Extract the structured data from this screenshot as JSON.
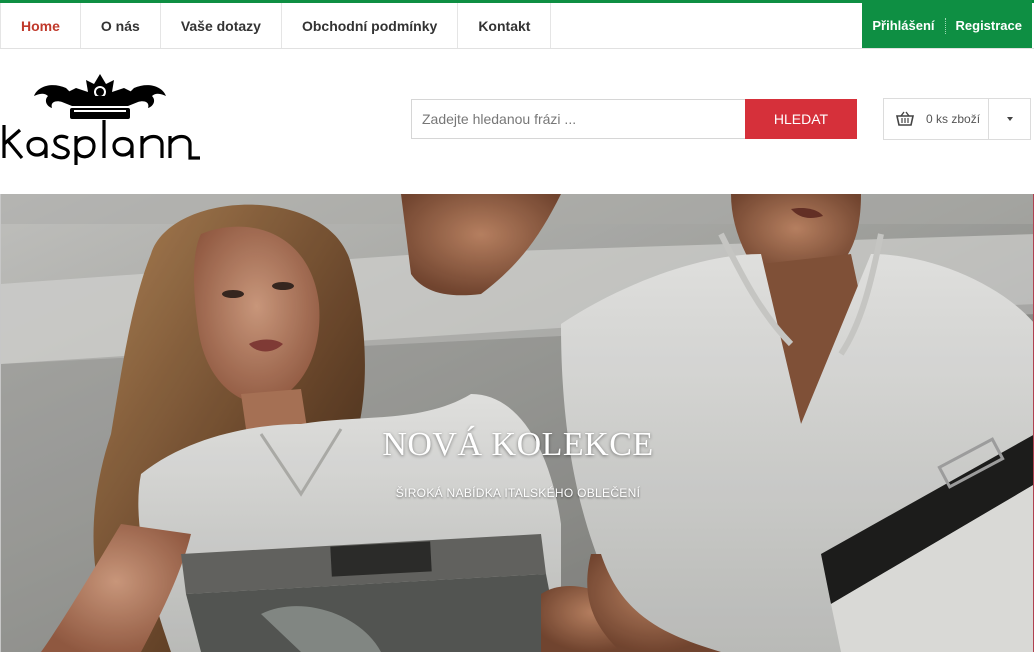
{
  "nav": {
    "items": [
      {
        "label": "Home",
        "active": true
      },
      {
        "label": "O nás"
      },
      {
        "label": "Vaše dotazy"
      },
      {
        "label": "Obchodní podmínky"
      },
      {
        "label": "Kontakt"
      }
    ],
    "login": "Přihlášení",
    "register": "Registrace"
  },
  "brand": {
    "logo_text": "kasplan"
  },
  "search": {
    "placeholder": "Zadejte hledanou frázi ...",
    "button": "HLEDAT"
  },
  "cart": {
    "label": "0 ks zboží",
    "icon": "basket-icon"
  },
  "hero": {
    "title": "NOVÁ KOLEKCE",
    "subtitle": "ŠIROKÁ NABÍDKA ITALSKÉHO OBLEČENÍ"
  },
  "colors": {
    "green": "#0e8f43",
    "red": "#d6303a",
    "active_nav": "#c0392b"
  }
}
